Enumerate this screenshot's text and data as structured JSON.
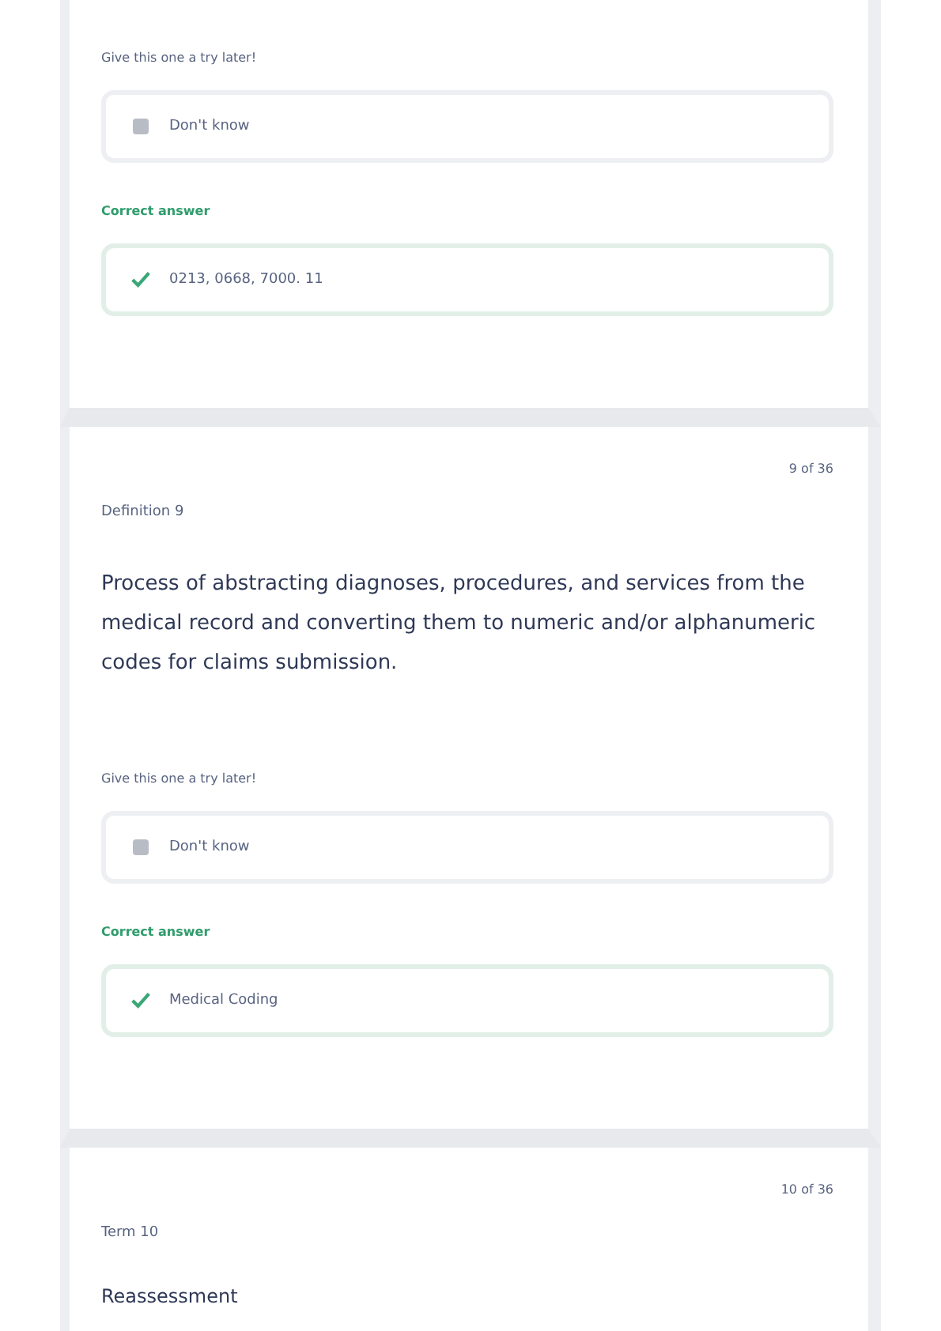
{
  "cards": [
    {
      "try_label": "Give this one a try later!",
      "skip_answer": "Don't know",
      "correct_label": "Correct answer",
      "correct_answer": "0213, 0668, 7000. 11"
    },
    {
      "counter": "9 of 36",
      "label": "Definition 9",
      "prompt": "Process of abstracting diagnoses, procedures, and services from the medical record and converting them to numeric and/or alphanumeric codes for claims submission.",
      "try_label": "Give this one a try later!",
      "skip_answer": "Don't know",
      "correct_label": "Correct answer",
      "correct_answer": "Medical Coding"
    },
    {
      "counter": "10 of 36",
      "label": "Term 10",
      "prompt": "Reassessment"
    }
  ]
}
